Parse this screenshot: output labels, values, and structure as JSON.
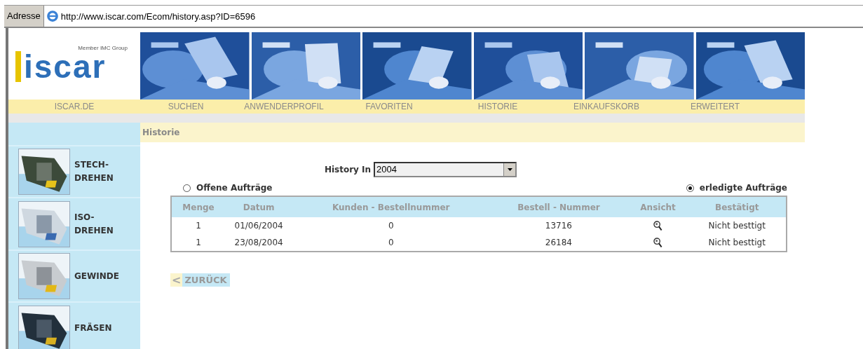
{
  "address_bar": {
    "label": "Adresse",
    "url": "http://www.iscar.com/Ecom/history.asp?ID=6596"
  },
  "logo": {
    "tagline": "Member IMC Group",
    "wordmark": "iscar"
  },
  "nav": [
    "ISCAR.DE",
    "SUCHEN",
    "ANWENDERPROFIL",
    "FAVORITEN",
    "HISTORIE",
    "EINKAUFSKORB",
    "ERWEITERT"
  ],
  "page_title": "Historie",
  "sidebar": {
    "items": [
      {
        "label": "STECH-\nDREHEN"
      },
      {
        "label": "ISO-\nDREHEN"
      },
      {
        "label": "GEWINDE"
      },
      {
        "label": "FRÄSEN"
      }
    ]
  },
  "history_filter": {
    "label": "History In",
    "value": "2004"
  },
  "order_types": [
    {
      "label": "Offene Aufträge",
      "selected": false
    },
    {
      "label": "erledigte Aufträge",
      "selected": true
    }
  ],
  "table": {
    "columns": [
      "Menge",
      "Datum",
      "Kunden - Bestellnummer",
      "Bestell - Nummer",
      "Ansicht",
      "Bestätigt"
    ],
    "rows": [
      [
        "1",
        "01/06/2004",
        "0",
        "13716",
        "",
        "Nicht besttigt"
      ],
      [
        "1",
        "23/08/2004",
        "0",
        "26184",
        "",
        "Nicht besttigt"
      ]
    ]
  },
  "back_link": {
    "arrow": "<",
    "label": "ZURÜCK"
  }
}
